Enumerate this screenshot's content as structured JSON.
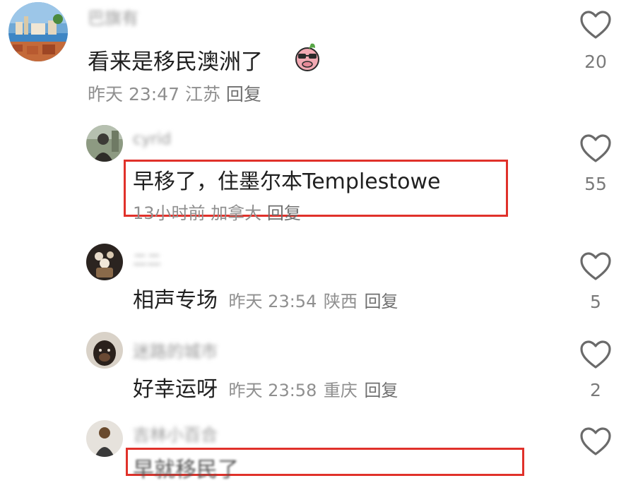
{
  "comments": [
    {
      "username": "巴旗有",
      "text": "看来是移民澳洲了",
      "time": "昨天 23:47",
      "location": "江苏",
      "reply_label": "回复",
      "likes": "20",
      "avatar_icon": "coastal-town-icon",
      "emoji_icon": "pig-sunglasses-emoji-icon",
      "reply_to": null
    },
    {
      "username": "cyrid",
      "text": "早移了，住墨尔本Templestowe",
      "time": "13小时前",
      "location": "加拿大",
      "reply_label": "回复",
      "likes": "55",
      "avatar_icon": "figure-photo-icon",
      "highlighted": true
    },
    {
      "username": "二二",
      "text": "相声专场",
      "time": "昨天 23:54",
      "location": "陕西",
      "reply_label": "回复",
      "likes": "5",
      "avatar_icon": "drink-cup-icon"
    },
    {
      "username": "迷路的城市",
      "text": "好幸运呀",
      "time": "昨天 23:58",
      "location": "重庆",
      "reply_label": "回复",
      "likes": "2",
      "avatar_icon": "dog-icon"
    },
    {
      "username": "吉林小百合",
      "text": "早就移民了",
      "avatar_icon": "figure-icon",
      "highlighted": true
    }
  ],
  "colors": {
    "highlight": "#e0312a",
    "meta": "#8f8f8f",
    "heart": "#6a6a6a"
  }
}
